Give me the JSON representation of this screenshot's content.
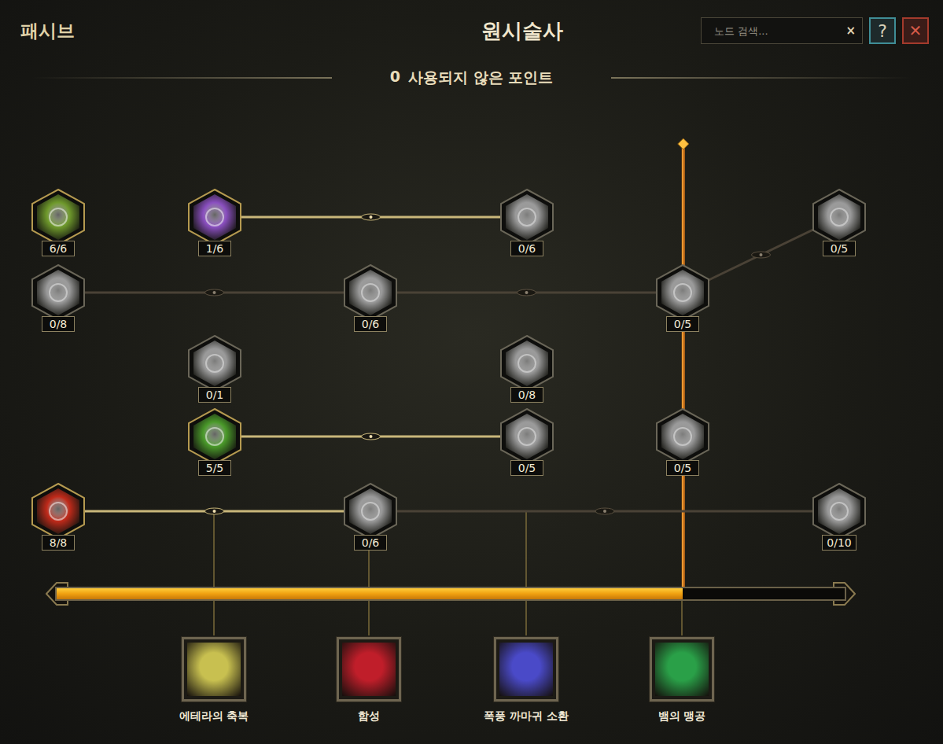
{
  "header": {
    "section": "패시브",
    "title": "원시술사",
    "search": {
      "placeholder": "노드 검색...",
      "clear": "×"
    },
    "help": "?",
    "close": "✕"
  },
  "unused_points": {
    "count": "0",
    "label": "사용되지 않은 포인트"
  },
  "nodes": [
    {
      "points": "6/6",
      "allocated": true,
      "color": "#6f9a2c"
    },
    {
      "points": "1/6",
      "allocated": true,
      "color": "#8a4fc0"
    },
    {
      "points": "0/6",
      "allocated": false,
      "color": "#9a9a9a"
    },
    {
      "points": "0/5",
      "allocated": false,
      "color": "#9a9a9a"
    },
    {
      "points": "0/8",
      "allocated": false,
      "color": "#9a9a9a"
    },
    {
      "points": "0/6",
      "allocated": false,
      "color": "#9a9a9a"
    },
    {
      "points": "0/5",
      "allocated": false,
      "color": "#9a9a9a"
    },
    {
      "points": "0/1",
      "allocated": false,
      "color": "#9a9a9a"
    },
    {
      "points": "0/8",
      "allocated": false,
      "color": "#9a9a9a"
    },
    {
      "points": "5/5",
      "allocated": true,
      "color": "#4a9a2a"
    },
    {
      "points": "0/5",
      "allocated": false,
      "color": "#9a9a9a"
    },
    {
      "points": "0/5",
      "allocated": false,
      "color": "#9a9a9a"
    },
    {
      "points": "8/8",
      "allocated": true,
      "color": "#c02a1a"
    },
    {
      "points": "0/6",
      "allocated": false,
      "color": "#9a9a9a"
    },
    {
      "points": "0/10",
      "allocated": false,
      "color": "#9a9a9a"
    }
  ],
  "connections": [
    {
      "from": 1,
      "to": 2,
      "active": true
    },
    {
      "from": 4,
      "to": 5,
      "active": false
    },
    {
      "from": 5,
      "to": 6,
      "active": false
    },
    {
      "from": 6,
      "to": 3,
      "active": false
    },
    {
      "from": 9,
      "to": 10,
      "active": true
    },
    {
      "from": 12,
      "to": 13,
      "active": true
    },
    {
      "from": 13,
      "to": 14,
      "active": false
    }
  ],
  "progress": {
    "level": 0.794
  },
  "abilities": [
    {
      "label": "에테라의 축복",
      "color": "#c8c050"
    },
    {
      "label": "함성",
      "color": "#c01e2a"
    },
    {
      "label": "폭풍 까마귀 소환",
      "color": "#4a4ac8"
    },
    {
      "label": "뱀의 맹공",
      "color": "#2aa048"
    }
  ]
}
